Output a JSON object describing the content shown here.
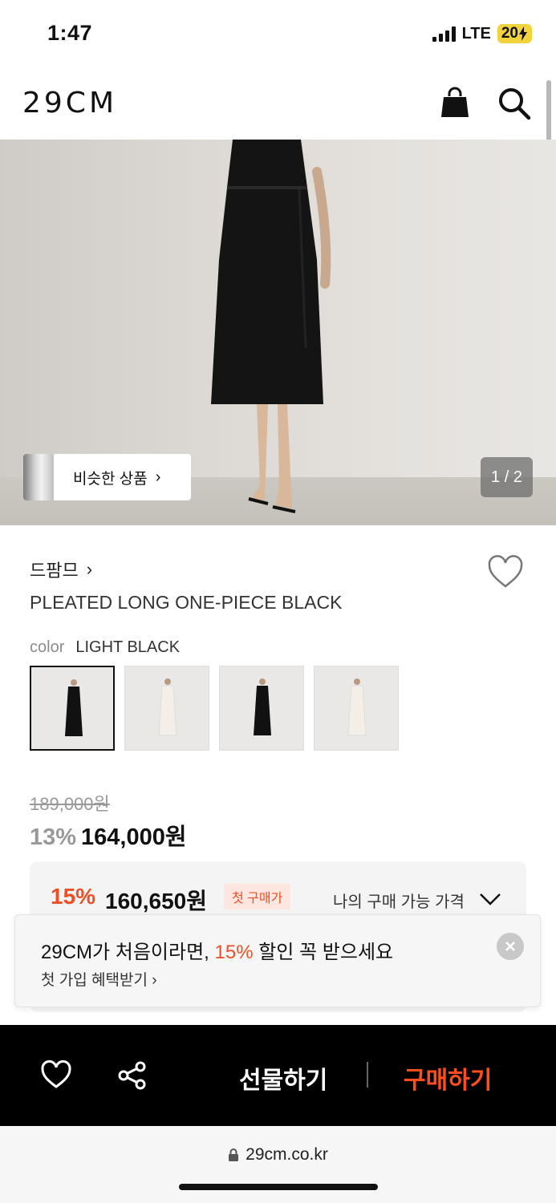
{
  "status_bar": {
    "time": "1:47",
    "network": "LTE",
    "battery": "20"
  },
  "header": {
    "logo": "29CM"
  },
  "hero": {
    "similar_label": "비슷한 상품",
    "pager": "1 / 2"
  },
  "product": {
    "brand": "드팜므",
    "name": "PLEATED LONG ONE-PIECE BLACK",
    "color_label": "color",
    "color_value": "LIGHT BLACK",
    "color_options": [
      "black",
      "ivory",
      "black",
      "ivory"
    ],
    "original_price": "189,000원",
    "discount": "13%",
    "price": "164,000원"
  },
  "my_price": {
    "discount": "15%",
    "price": "160,650원",
    "badge": "첫 구매가",
    "label": "나의 구매 가능 가격"
  },
  "toast": {
    "title_prefix": "29CM가 처음이라면, ",
    "title_highlight": "15%",
    "title_suffix": " 할인 꼭 받으세요",
    "sub": "첫 가입 혜택받기"
  },
  "action_bar": {
    "gift": "선물하기",
    "buy": "구매하기"
  },
  "url_bar": {
    "url": "29cm.co.kr"
  },
  "colors": {
    "accent": "#f04e23",
    "buy": "#ff4d1c"
  }
}
